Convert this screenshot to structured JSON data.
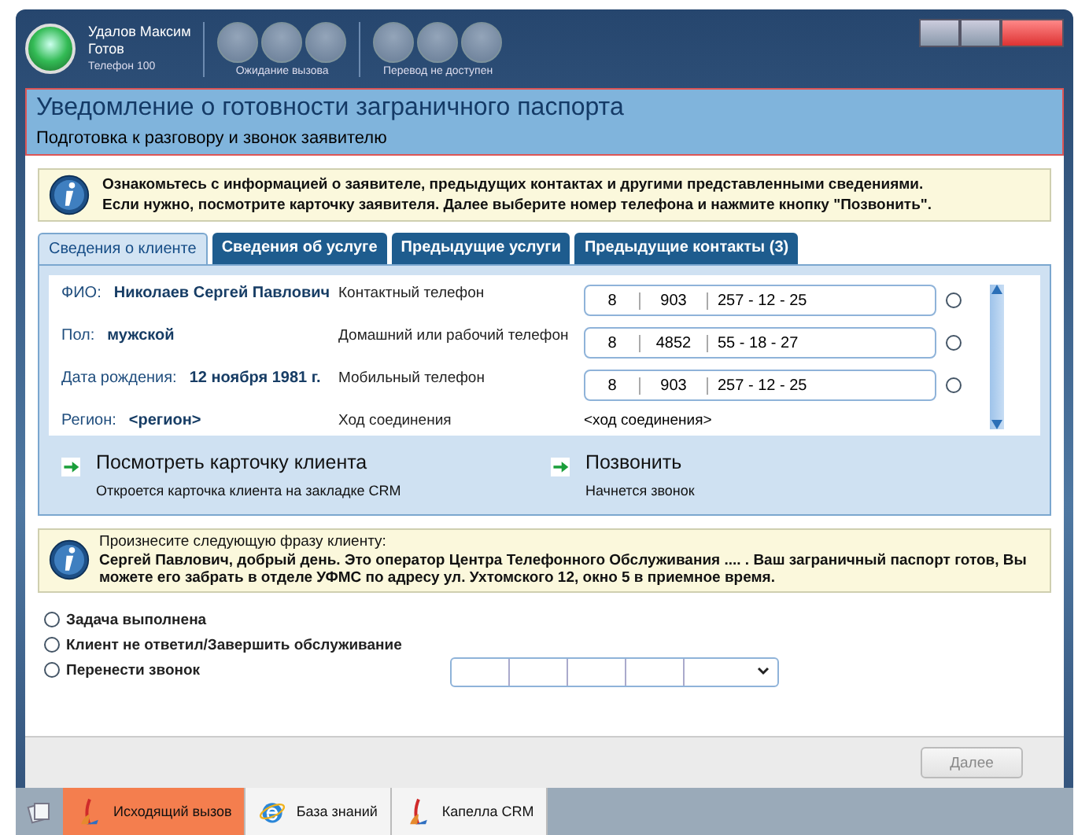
{
  "agent": {
    "name": "Удалов Максим",
    "status": "Готов",
    "phone": "Телефон 100"
  },
  "toolbar_groups": [
    {
      "label": "Ожидание вызова",
      "disabled": true
    },
    {
      "label": "Перевод не доступен",
      "disabled": true
    }
  ],
  "header": {
    "title": "Уведомление о готовности заграничного паспорта",
    "subtitle": "Подготовка к разговору и звонок заявителю"
  },
  "info": {
    "lines": [
      "Ознакомьтесь с информацией о заявителе, предыдущих контактах и другими представленными сведениями.",
      "Если нужно, посмотрите карточку заявителя. Далее выберите номер телефона и нажмите кнопку \"Позвонить\"."
    ]
  },
  "tabs": [
    {
      "label": "Сведения о клиенте",
      "selected": true
    },
    {
      "label": "Сведения об услуге",
      "selected": false
    },
    {
      "label": "Предыдущие услуги",
      "selected": false
    },
    {
      "label": "Предыдущие контакты (3)",
      "selected": false
    }
  ],
  "client_fields": [
    {
      "label": "ФИО:",
      "value": "Николаев Сергей Павлович"
    },
    {
      "label": "Пол:",
      "value": "мужской"
    },
    {
      "label": "Дата рождения:",
      "value": "12 ноября 1981 г."
    },
    {
      "label": "Регион:",
      "value": "<регион>"
    }
  ],
  "phones": [
    {
      "label": "Контактный телефон",
      "segments": [
        "8",
        "903",
        "257 - 12 - 25"
      ],
      "selected": false
    },
    {
      "label": "Домашний или рабочий телефон",
      "segments": [
        "8",
        "4852",
        "55 - 18 - 27"
      ],
      "selected": false
    },
    {
      "label": "Мобильный телефон",
      "segments": [
        "8",
        "903",
        "257 - 12 - 25"
      ],
      "selected": false
    }
  ],
  "connection": {
    "label": "Ход соединения",
    "value": "<ход соединения>"
  },
  "actions": [
    {
      "title": "Посмотреть карточку клиента",
      "description": "Откроется карточка клиента на закладке CRM"
    },
    {
      "title": "Позвонить",
      "description": "Начнется звонок"
    }
  ],
  "script": {
    "prompt": "Произнесите следующую фразу клиенту:",
    "text": "Сергей Павлович, добрый день. Это оператор Центра Телефонного Обслуживания .... . Ваш заграничный паспорт готов, Вы можете его забрать в отделе УФМС по адресу ул. Ухтомского 12, окно 5 в приемное время."
  },
  "outcomes": [
    {
      "label": "Задача выполнена",
      "selected": false
    },
    {
      "label": "Клиент не ответил/Завершить обслуживание",
      "selected": false
    },
    {
      "label": "Перенести звонок",
      "selected": false
    }
  ],
  "next_button": {
    "label": "Далее",
    "disabled": true
  },
  "taskbar": [
    {
      "label": "Исходящий вызов",
      "kind": "call",
      "selected": true
    },
    {
      "label": "База знаний",
      "kind": "browser",
      "selected": false
    },
    {
      "label": "Капелла CRM",
      "kind": "crm",
      "selected": false
    }
  ]
}
